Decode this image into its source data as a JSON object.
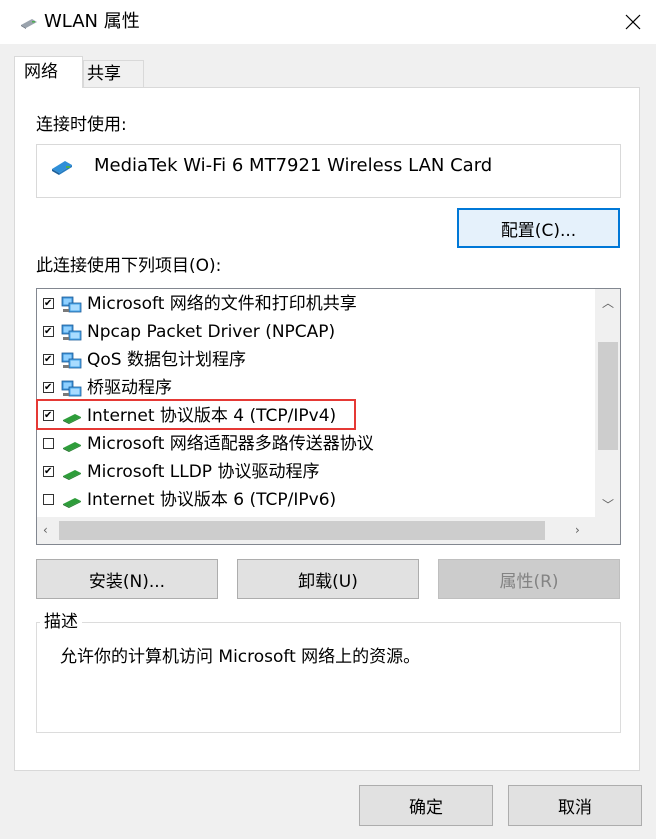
{
  "window": {
    "title": "WLAN 属性"
  },
  "tabs": [
    {
      "label": "网络",
      "active": true
    },
    {
      "label": "共享",
      "active": false
    }
  ],
  "connect_using_label": "连接时使用:",
  "adapter": {
    "name": "MediaTek Wi-Fi 6 MT7921 Wireless LAN Card",
    "icon": "network-adapter-icon"
  },
  "configure_button": "配置(C)...",
  "items_label": "此连接使用下列项目(O):",
  "items": [
    {
      "label": "Microsoft 网络的文件和打印机共享",
      "checked": true,
      "icon": "client-network-icon"
    },
    {
      "label": "Npcap Packet Driver (NPCAP)",
      "checked": true,
      "icon": "client-network-icon"
    },
    {
      "label": "QoS 数据包计划程序",
      "checked": true,
      "icon": "client-network-icon"
    },
    {
      "label": "桥驱动程序",
      "checked": true,
      "icon": "client-network-icon"
    },
    {
      "label": "Internet 协议版本 4 (TCP/IPv4)",
      "checked": true,
      "icon": "protocol-icon",
      "highlighted": true
    },
    {
      "label": "Microsoft 网络适配器多路传送器协议",
      "checked": false,
      "icon": "protocol-icon"
    },
    {
      "label": "Microsoft LLDP 协议驱动程序",
      "checked": true,
      "icon": "protocol-icon"
    },
    {
      "label": "Internet 协议版本 6 (TCP/IPv6)",
      "checked": false,
      "icon": "protocol-icon"
    }
  ],
  "buttons": {
    "install": "安装(N)...",
    "uninstall": "卸载(U)",
    "properties": "属性(R)"
  },
  "description": {
    "title": "描述",
    "text": "允许你的计算机访问 Microsoft 网络上的资源。"
  },
  "footer": {
    "ok": "确定",
    "cancel": "取消"
  },
  "colors": {
    "highlight_border": "#e53935",
    "accent": "#0078d7"
  }
}
